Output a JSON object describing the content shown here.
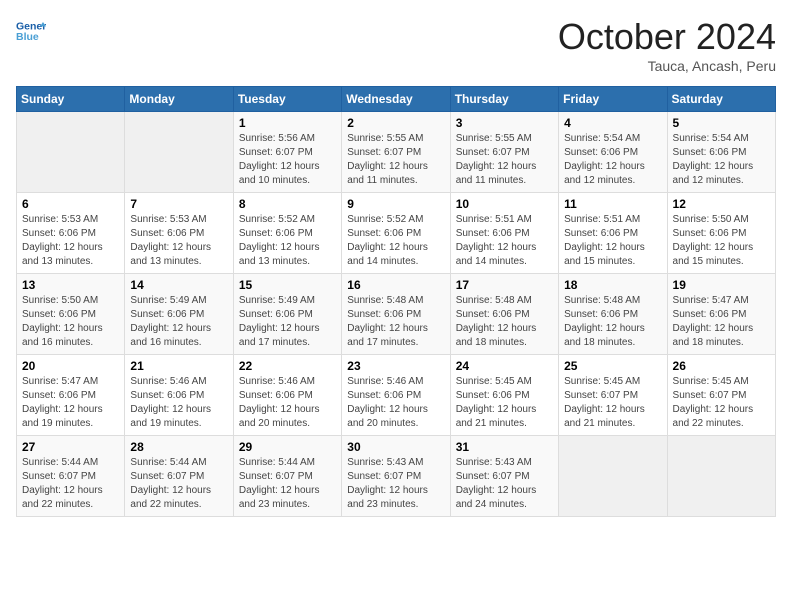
{
  "header": {
    "logo_line1": "General",
    "logo_line2": "Blue",
    "month": "October 2024",
    "location": "Tauca, Ancash, Peru"
  },
  "weekdays": [
    "Sunday",
    "Monday",
    "Tuesday",
    "Wednesday",
    "Thursday",
    "Friday",
    "Saturday"
  ],
  "weeks": [
    [
      {
        "day": "",
        "info": ""
      },
      {
        "day": "",
        "info": ""
      },
      {
        "day": "1",
        "info": "Sunrise: 5:56 AM\nSunset: 6:07 PM\nDaylight: 12 hours and 10 minutes."
      },
      {
        "day": "2",
        "info": "Sunrise: 5:55 AM\nSunset: 6:07 PM\nDaylight: 12 hours and 11 minutes."
      },
      {
        "day": "3",
        "info": "Sunrise: 5:55 AM\nSunset: 6:07 PM\nDaylight: 12 hours and 11 minutes."
      },
      {
        "day": "4",
        "info": "Sunrise: 5:54 AM\nSunset: 6:06 PM\nDaylight: 12 hours and 12 minutes."
      },
      {
        "day": "5",
        "info": "Sunrise: 5:54 AM\nSunset: 6:06 PM\nDaylight: 12 hours and 12 minutes."
      }
    ],
    [
      {
        "day": "6",
        "info": "Sunrise: 5:53 AM\nSunset: 6:06 PM\nDaylight: 12 hours and 13 minutes."
      },
      {
        "day": "7",
        "info": "Sunrise: 5:53 AM\nSunset: 6:06 PM\nDaylight: 12 hours and 13 minutes."
      },
      {
        "day": "8",
        "info": "Sunrise: 5:52 AM\nSunset: 6:06 PM\nDaylight: 12 hours and 13 minutes."
      },
      {
        "day": "9",
        "info": "Sunrise: 5:52 AM\nSunset: 6:06 PM\nDaylight: 12 hours and 14 minutes."
      },
      {
        "day": "10",
        "info": "Sunrise: 5:51 AM\nSunset: 6:06 PM\nDaylight: 12 hours and 14 minutes."
      },
      {
        "day": "11",
        "info": "Sunrise: 5:51 AM\nSunset: 6:06 PM\nDaylight: 12 hours and 15 minutes."
      },
      {
        "day": "12",
        "info": "Sunrise: 5:50 AM\nSunset: 6:06 PM\nDaylight: 12 hours and 15 minutes."
      }
    ],
    [
      {
        "day": "13",
        "info": "Sunrise: 5:50 AM\nSunset: 6:06 PM\nDaylight: 12 hours and 16 minutes."
      },
      {
        "day": "14",
        "info": "Sunrise: 5:49 AM\nSunset: 6:06 PM\nDaylight: 12 hours and 16 minutes."
      },
      {
        "day": "15",
        "info": "Sunrise: 5:49 AM\nSunset: 6:06 PM\nDaylight: 12 hours and 17 minutes."
      },
      {
        "day": "16",
        "info": "Sunrise: 5:48 AM\nSunset: 6:06 PM\nDaylight: 12 hours and 17 minutes."
      },
      {
        "day": "17",
        "info": "Sunrise: 5:48 AM\nSunset: 6:06 PM\nDaylight: 12 hours and 18 minutes."
      },
      {
        "day": "18",
        "info": "Sunrise: 5:48 AM\nSunset: 6:06 PM\nDaylight: 12 hours and 18 minutes."
      },
      {
        "day": "19",
        "info": "Sunrise: 5:47 AM\nSunset: 6:06 PM\nDaylight: 12 hours and 18 minutes."
      }
    ],
    [
      {
        "day": "20",
        "info": "Sunrise: 5:47 AM\nSunset: 6:06 PM\nDaylight: 12 hours and 19 minutes."
      },
      {
        "day": "21",
        "info": "Sunrise: 5:46 AM\nSunset: 6:06 PM\nDaylight: 12 hours and 19 minutes."
      },
      {
        "day": "22",
        "info": "Sunrise: 5:46 AM\nSunset: 6:06 PM\nDaylight: 12 hours and 20 minutes."
      },
      {
        "day": "23",
        "info": "Sunrise: 5:46 AM\nSunset: 6:06 PM\nDaylight: 12 hours and 20 minutes."
      },
      {
        "day": "24",
        "info": "Sunrise: 5:45 AM\nSunset: 6:06 PM\nDaylight: 12 hours and 21 minutes."
      },
      {
        "day": "25",
        "info": "Sunrise: 5:45 AM\nSunset: 6:07 PM\nDaylight: 12 hours and 21 minutes."
      },
      {
        "day": "26",
        "info": "Sunrise: 5:45 AM\nSunset: 6:07 PM\nDaylight: 12 hours and 22 minutes."
      }
    ],
    [
      {
        "day": "27",
        "info": "Sunrise: 5:44 AM\nSunset: 6:07 PM\nDaylight: 12 hours and 22 minutes."
      },
      {
        "day": "28",
        "info": "Sunrise: 5:44 AM\nSunset: 6:07 PM\nDaylight: 12 hours and 22 minutes."
      },
      {
        "day": "29",
        "info": "Sunrise: 5:44 AM\nSunset: 6:07 PM\nDaylight: 12 hours and 23 minutes."
      },
      {
        "day": "30",
        "info": "Sunrise: 5:43 AM\nSunset: 6:07 PM\nDaylight: 12 hours and 23 minutes."
      },
      {
        "day": "31",
        "info": "Sunrise: 5:43 AM\nSunset: 6:07 PM\nDaylight: 12 hours and 24 minutes."
      },
      {
        "day": "",
        "info": ""
      },
      {
        "day": "",
        "info": ""
      }
    ]
  ]
}
